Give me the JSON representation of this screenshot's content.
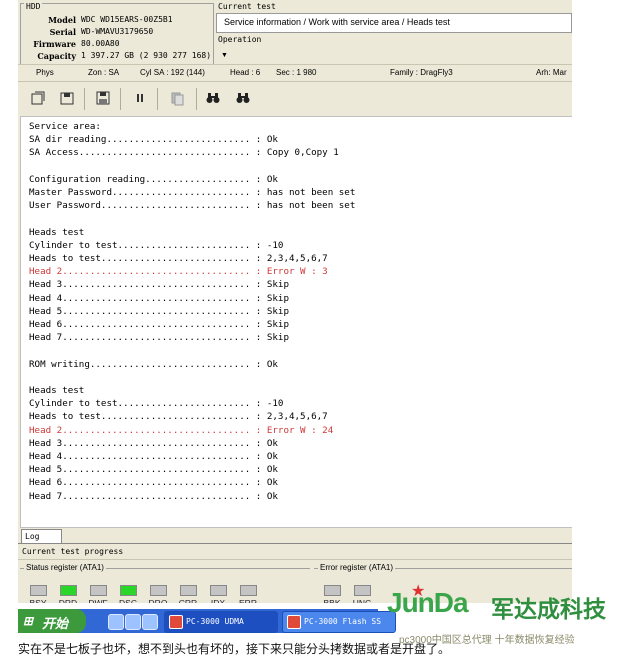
{
  "hdd": {
    "caption": "HDD",
    "rows": [
      {
        "key": "Model",
        "value": "WDC WD15EARS-00Z5B1"
      },
      {
        "key": "Serial",
        "value": "WD-WMAVU3179650"
      },
      {
        "key": "Firmware",
        "value": "80.00A80"
      },
      {
        "key": "Capacity",
        "value": "1 397.27 GB (2 930 277 168)"
      }
    ]
  },
  "current_test": {
    "caption": "Current test",
    "value": "Service information / Work with service area / Heads test",
    "operation_caption": "Operation"
  },
  "info_bar": {
    "phys": "Phys",
    "zone": "Zon : SA",
    "cyl": "Cyl SA : 192 (144)",
    "head": "Head : 6",
    "sec": "Sec : 1 980",
    "family": "Family : DragFly3",
    "arh": "Arh: Mar"
  },
  "toolbar": {
    "icons": [
      "open-icon",
      "load-icon",
      "save-icon",
      "pause-icon",
      "copy-icon",
      "binoculars-icon",
      "binoculars-next-icon"
    ]
  },
  "log": {
    "lines": [
      {
        "text": "Service area:",
        "red": false
      },
      {
        "text": "SA dir reading.......................... : Ok",
        "red": false
      },
      {
        "text": "SA Access............................... : Copy 0,Copy 1",
        "red": false
      },
      {
        "text": "",
        "red": false
      },
      {
        "text": "Configuration reading................... : Ok",
        "red": false
      },
      {
        "text": "Master Password......................... : has not been set",
        "red": false
      },
      {
        "text": "User Password........................... : has not been set",
        "red": false
      },
      {
        "text": "",
        "red": false
      },
      {
        "text": "Heads test",
        "red": false
      },
      {
        "text": "Cylinder to test........................ : -10",
        "red": false
      },
      {
        "text": "Heads to test........................... : 2,3,4,5,6,7",
        "red": false
      },
      {
        "text": "Head 2.................................. : Error W : 3",
        "red": true
      },
      {
        "text": "Head 3.................................. : Skip",
        "red": false
      },
      {
        "text": "Head 4.................................. : Skip",
        "red": false
      },
      {
        "text": "Head 5.................................. : Skip",
        "red": false
      },
      {
        "text": "Head 6.................................. : Skip",
        "red": false
      },
      {
        "text": "Head 7.................................. : Skip",
        "red": false
      },
      {
        "text": "",
        "red": false
      },
      {
        "text": "ROM writing............................. : Ok",
        "red": false
      },
      {
        "text": "",
        "red": false
      },
      {
        "text": "Heads test",
        "red": false
      },
      {
        "text": "Cylinder to test........................ : -10",
        "red": false
      },
      {
        "text": "Heads to test........................... : 2,3,4,5,6,7",
        "red": false
      },
      {
        "text": "Head 2.................................. : Error W : 24",
        "red": true
      },
      {
        "text": "Head 3.................................. : Ok",
        "red": false
      },
      {
        "text": "Head 4.................................. : Ok",
        "red": false
      },
      {
        "text": "Head 5.................................. : Ok",
        "red": false
      },
      {
        "text": "Head 6.................................. : Ok",
        "red": false
      },
      {
        "text": "Head 7.................................. : Ok",
        "red": false
      }
    ]
  },
  "log_tab": "Log",
  "progress_caption": "Current test progress",
  "status_register": {
    "caption": "Status register (ATA1)",
    "leds": [
      {
        "label": "BSY",
        "on": false
      },
      {
        "label": "DRD",
        "on": true
      },
      {
        "label": "DWF",
        "on": false
      },
      {
        "label": "DSC",
        "on": true
      },
      {
        "label": "DRQ",
        "on": false
      },
      {
        "label": "CRR",
        "on": false
      },
      {
        "label": "IDX",
        "on": false
      },
      {
        "label": "ERR",
        "on": false
      }
    ]
  },
  "error_register": {
    "caption": "Error register (ATA1)",
    "leds": [
      {
        "label": "BBK",
        "on": false
      },
      {
        "label": "UNC",
        "on": false
      }
    ]
  },
  "taskbar": {
    "start_label": "开始",
    "buttons": [
      {
        "label": "PC-3000 UDMA",
        "active": true
      },
      {
        "label": "PC-3000 Flash SS",
        "active": false
      }
    ]
  },
  "brand": {
    "logo": "JunDa",
    "name": "军达成科技",
    "slogan": "pc3000中国区总代理 十年数据恢复经验"
  },
  "caption": "实在不是七板子也坏，想不到头也有坏的，接下来只能分头拷数据或者是开盘了。",
  "colors": {
    "window_bg": "#ece9d8",
    "led_on": "#29d629",
    "error_text": "#d03838",
    "taskbar": "#3168d5",
    "brand_green": "#3aa54a"
  }
}
